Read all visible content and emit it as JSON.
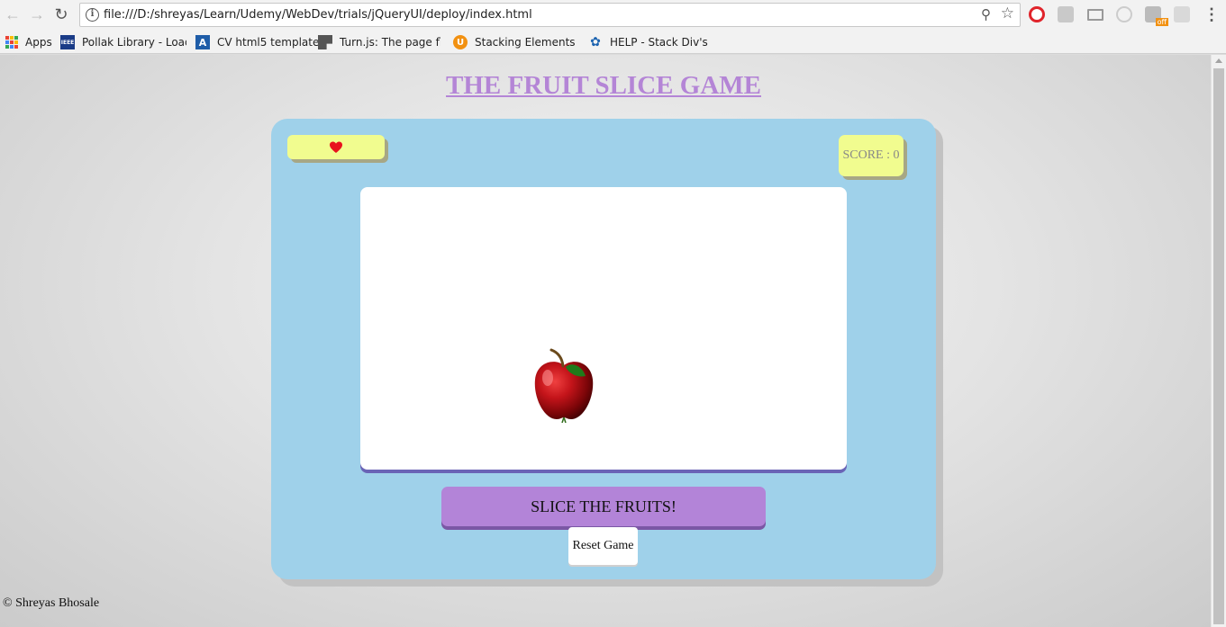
{
  "browser": {
    "url": "file:///D:/shreyas/Learn/Udemy/WebDev/trials/jQueryUI/deploy/index.html",
    "bookmarks": [
      {
        "label": "Apps",
        "icon": "apps-grid-icon"
      },
      {
        "label": "Pollak Library - Loadi",
        "icon": "ieee-icon",
        "color": "#1a3b87"
      },
      {
        "label": "CV html5 template",
        "icon": "a-letter-icon",
        "color": "#1f5da8"
      },
      {
        "label": "Turn.js: The page flip",
        "icon": "turnjs-icon",
        "color": "#555555"
      },
      {
        "label": "Stacking Elements | jQ",
        "icon": "u-badge-icon",
        "color": "#f29111"
      },
      {
        "label": "HELP - Stack Div's jQu",
        "icon": "jquery-icon",
        "color": "#1c63b0"
      }
    ]
  },
  "game": {
    "title": "THE FRUIT SLICE GAME",
    "lives": 1,
    "score_label": "SCORE : 0",
    "fruit": "apple",
    "start_button": "SLICE THE FRUITS!",
    "reset_button": "Reset Game"
  },
  "footer": "© Shreyas Bhosale",
  "colors": {
    "title": "#b485d6",
    "container": "#9fd1ea",
    "panel": "#f1fc8f",
    "button": "#b384d8",
    "heart": "#e8121d"
  }
}
